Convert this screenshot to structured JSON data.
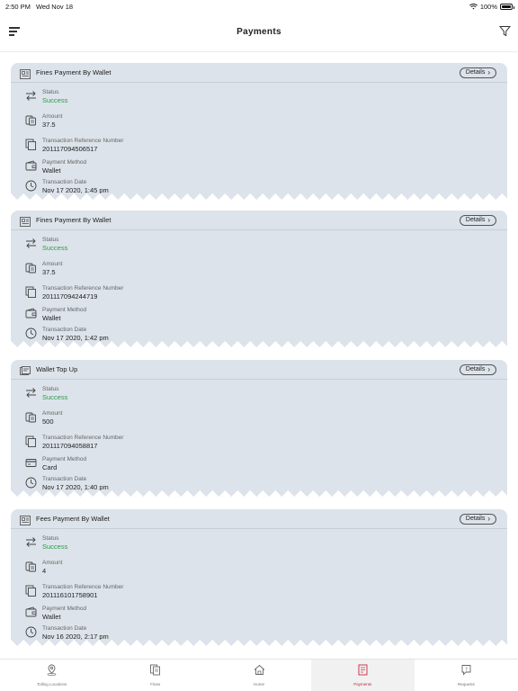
{
  "status_bar": {
    "time": "2:50 PM",
    "date": "Wed Nov 18",
    "battery": "100%"
  },
  "header": {
    "title": "Payments"
  },
  "labels": {
    "status": "Status",
    "amount": "Amount",
    "ref": "Transaction Reference Number",
    "method": "Payment Method",
    "date": "Transaction Date",
    "details": "Details"
  },
  "payments": [
    {
      "title": "Fines Payment By Wallet",
      "status": "Success",
      "amount": "37.5",
      "ref": "201117094506517",
      "method": "Wallet",
      "date": "Nov 17 2020, 1:45 pm"
    },
    {
      "title": "Fines Payment By Wallet",
      "status": "Success",
      "amount": "37.5",
      "ref": "201117094244719",
      "method": "Wallet",
      "date": "Nov 17 2020, 1:42 pm"
    },
    {
      "title": "Wallet Top Up",
      "status": "Success",
      "amount": "500",
      "ref": "201117094058817",
      "method": "Card",
      "date": "Nov 17 2020, 1:40 pm"
    },
    {
      "title": "Fees Payment By Wallet",
      "status": "Success",
      "amount": "4",
      "ref": "201116101758901",
      "method": "Wallet",
      "date": "Nov 16 2020, 2:17 pm"
    }
  ],
  "tabs": [
    {
      "label": "Tolling Locations",
      "icon": "location-pin-icon"
    },
    {
      "label": "Fines",
      "icon": "fines-document-icon"
    },
    {
      "label": "Home",
      "icon": "home-icon"
    },
    {
      "label": "Payments",
      "icon": "payments-icon",
      "active": true
    },
    {
      "label": "Requests",
      "icon": "requests-icon"
    }
  ],
  "colors": {
    "success": "#2a9d4a",
    "active_tab": "#c8283c",
    "card_bg": "#dde3ea"
  }
}
